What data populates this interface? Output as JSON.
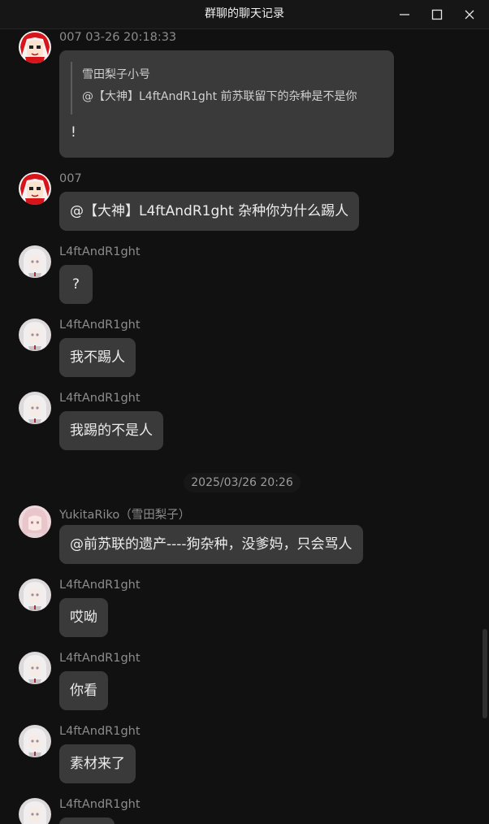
{
  "window": {
    "title": "群聊的聊天记录"
  },
  "messages": [
    {
      "sender": "007",
      "time": "03-26 20:18:33",
      "avatar": "red-hair-avatar",
      "quote": {
        "name": "雪田梨子小号",
        "text": "@【大神】L4ftAndR1ght 前苏联留下的杂种是不是你"
      },
      "text": "!"
    },
    {
      "sender": "007",
      "avatar": "red-hair-avatar",
      "text": "@【大神】L4ftAndR1ght 杂种你为什么踢人"
    },
    {
      "sender": "L4ftAndR1ght",
      "avatar": "white-hair-avatar",
      "text": "?"
    },
    {
      "sender": "L4ftAndR1ght",
      "avatar": "white-hair-avatar",
      "text": "我不踢人"
    },
    {
      "sender": "L4ftAndR1ght",
      "avatar": "white-hair-avatar",
      "text": "我踢的不是人"
    },
    {
      "sender": "YukitaRiko（雪田梨子）",
      "avatar": "pink-hair-avatar",
      "text": "@前苏联的遗产----狗杂种，没爹妈，只会骂人"
    },
    {
      "sender": "L4ftAndR1ght",
      "avatar": "white-hair-avatar",
      "text": "哎呦"
    },
    {
      "sender": "L4ftAndR1ght",
      "avatar": "white-hair-avatar",
      "text": "你看"
    },
    {
      "sender": "L4ftAndR1ght",
      "avatar": "white-hair-avatar",
      "text": "素材来了"
    },
    {
      "sender": "L4ftAndR1ght",
      "avatar": "white-hair-avatar",
      "text": ""
    }
  ],
  "time_divider": "2025/03/26 20:26",
  "colors": {
    "background": "#111111",
    "bubble": "#3a3a3a",
    "name": "#8c8c8c"
  }
}
